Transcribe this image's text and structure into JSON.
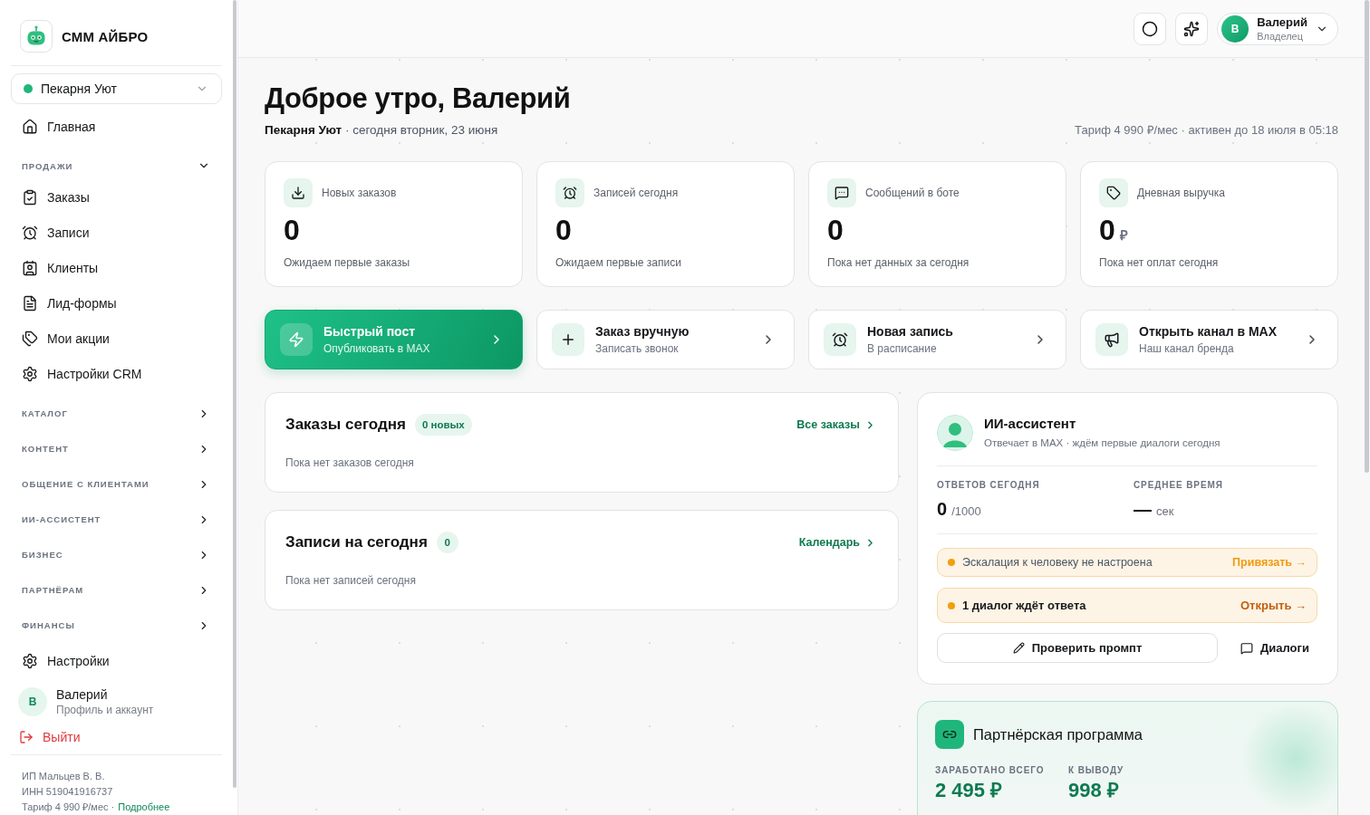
{
  "sidebar": {
    "brand": "СММ АЙБРО",
    "business": {
      "name": "Пекарня Уют"
    },
    "nav": [
      {
        "kind": "link",
        "label": "Главная",
        "selected": false
      },
      {
        "kind": "section",
        "label": "ПРОДАЖИ",
        "expanded": true,
        "items": [
          {
            "label": "Заказы",
            "selected": false
          },
          {
            "label": "Записи",
            "selected": false
          },
          {
            "label": "Клиенты",
            "selected": false
          },
          {
            "label": "Лид-формы",
            "selected": false
          },
          {
            "label": "Мои акции",
            "selected": false
          },
          {
            "label": "Настройки CRM",
            "selected": false
          }
        ]
      },
      {
        "kind": "section",
        "label": "КАТАЛОГ",
        "expanded": false
      },
      {
        "kind": "section",
        "label": "КОНТЕНТ",
        "expanded": false
      },
      {
        "kind": "section",
        "label": "ОБЩЕНИЕ С КЛИЕНТАМИ",
        "expanded": false
      },
      {
        "kind": "section",
        "label": "ИИ-АССИСТЕНТ",
        "expanded": false
      },
      {
        "kind": "section",
        "label": "БИЗНЕС",
        "expanded": false
      },
      {
        "kind": "section",
        "label": "ПАРТНЁРАМ",
        "expanded": false
      },
      {
        "kind": "section",
        "label": "ФИНАНСЫ",
        "expanded": false
      },
      {
        "kind": "link",
        "label": "Настройки",
        "selected": false
      }
    ],
    "profile": {
      "initial": "В",
      "name": "Валерий",
      "subtitle": "Профиль и аккаунт"
    },
    "logout": "Выйти",
    "legal": {
      "lines": [
        "ИП Мальцев В. В.",
        "ИНН 519041916737"
      ],
      "plan": "Тариф 4 990 ₽/мес ·",
      "link": "Подробнее"
    }
  },
  "topbar": {
    "user": {
      "initial": "В",
      "name": "Валерий",
      "role": "Владелец"
    }
  },
  "header": {
    "title": "Доброе утро, Валерий",
    "subtitle": "**Пекарня Уют** · сегодня вторник, 23 июня",
    "plan": "Тариф 4 990 ₽/мес · активен до 18 июля в 05:18"
  },
  "stats": [
    {
      "label": "Новых заказов",
      "value": "0",
      "note": "Ожидаем первые заказы"
    },
    {
      "label": "Записей сегодня",
      "value": "0",
      "note": "Ожидаем первые записи"
    },
    {
      "label": "Сообщений в боте",
      "value": "0",
      "note": "Пока нет данных за сегодня"
    },
    {
      "label": "Дневная выручка",
      "value": "0",
      "unit": "₽",
      "note": "Пока нет оплат сегодня"
    }
  ],
  "actions": [
    {
      "kind": "primary",
      "title": "Быстрый пост",
      "subtitle": "Опубликовать в MAX"
    },
    {
      "kind": "default",
      "title": "Заказ вручную",
      "subtitle": "Записать звонок"
    },
    {
      "kind": "default",
      "title": "Новая запись",
      "subtitle": "В расписание"
    },
    {
      "kind": "default",
      "title": "Открыть канал в MAX",
      "subtitle": "Наш канал бренда"
    }
  ],
  "panels": [
    {
      "title": "Заказы сегодня",
      "badge": "0 новых",
      "link": "Все заказы",
      "empty": "Пока нет заказов сегодня"
    },
    {
      "title": "Записи на сегодня",
      "badge": "0",
      "link": "Календарь",
      "empty": "Пока нет записей сегодня"
    }
  ],
  "assistant": {
    "title": "ИИ-ассистент",
    "subtitle": "Отвечает в MAX · ждём первые диалоги сегодня",
    "stats": [
      {
        "label": "ОТВЕТОВ СЕГОДНЯ",
        "value": "0",
        "unit": "/1000"
      },
      {
        "label": "СРЕДНЕЕ ВРЕМЯ",
        "value": "—",
        "unit": "сек"
      }
    ],
    "alerts": [
      {
        "kind": "notice",
        "text": "Эскалация к человеку не настроена",
        "action": "Привязать →"
      },
      {
        "kind": "urgent",
        "text": "1 диалог ждёт ответа",
        "action": "Открыть →"
      }
    ],
    "buttons": [
      {
        "kind": "outline",
        "label": "Проверить промпт"
      },
      {
        "kind": "ghost",
        "label": "Диалоги"
      }
    ]
  },
  "partner": {
    "title": "Партнёрская программа",
    "stats": [
      {
        "label": "ЗАРАБОТАНО ВСЕГО",
        "value": "2 495 ₽"
      },
      {
        "label": "К ВЫВОДУ",
        "value": "998 ₽"
      }
    ]
  }
}
